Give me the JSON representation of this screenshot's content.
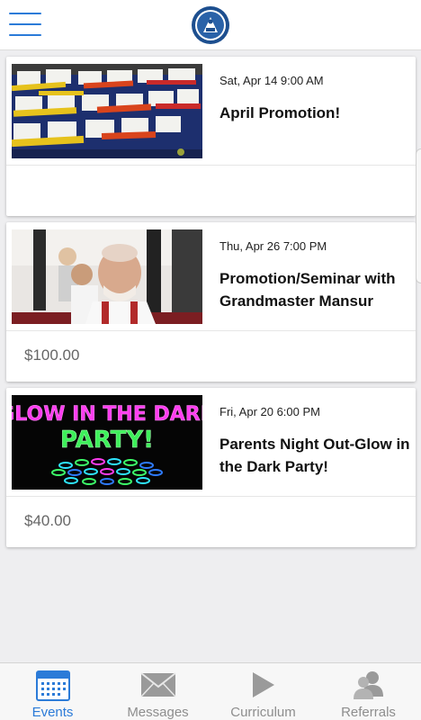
{
  "colors": {
    "accent": "#2b7bd8",
    "inactive": "#8e8e8e",
    "price": "#666666"
  },
  "header": {
    "menu_icon": "hamburger-menu-icon",
    "logo": "school-seal-logo"
  },
  "events": [
    {
      "date": "Sat, Apr 14 9:00 AM",
      "title": "April Promotion!",
      "price": "",
      "image": "belts-on-table"
    },
    {
      "date": "Thu, Apr 26 7:00 PM",
      "title": "Promotion/Seminar with Grandmaster Mansur",
      "price": "$100.00",
      "image": "grandmaster-photo"
    },
    {
      "date": "Fri, Apr 20 6:00 PM",
      "title": "Parents Night Out-Glow in the Dark Party!",
      "price": "$40.00",
      "image": "glow-party-poster",
      "image_text": {
        "line1": "GLOW IN THE DARK",
        "line2": "PARTY!"
      }
    }
  ],
  "tabbar": {
    "tabs": [
      {
        "label": "Events",
        "icon": "calendar-icon",
        "active": true
      },
      {
        "label": "Messages",
        "icon": "envelope-icon",
        "active": false
      },
      {
        "label": "Curriculum",
        "icon": "play-icon",
        "active": false
      },
      {
        "label": "Referrals",
        "icon": "people-icon",
        "active": false
      }
    ]
  }
}
